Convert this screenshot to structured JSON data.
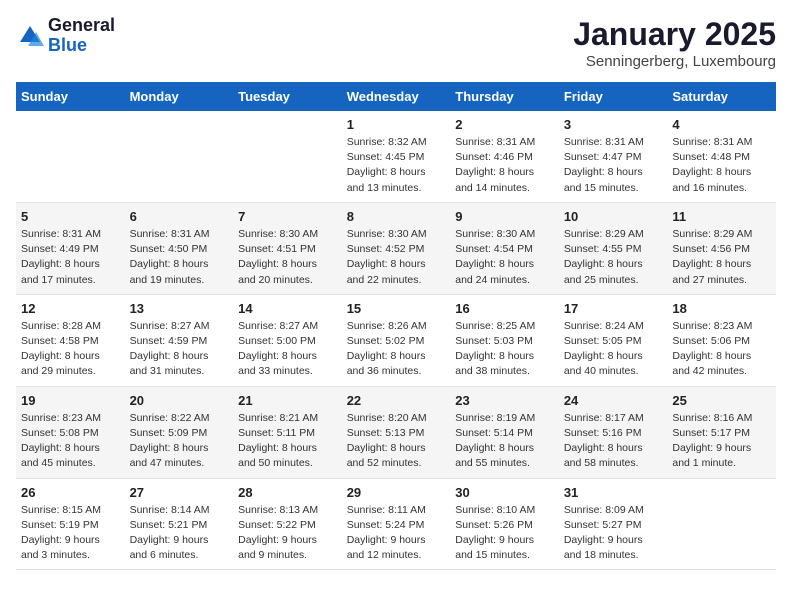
{
  "header": {
    "logo_general": "General",
    "logo_blue": "Blue",
    "title": "January 2025",
    "location": "Senningerberg, Luxembourg"
  },
  "days_of_week": [
    "Sunday",
    "Monday",
    "Tuesday",
    "Wednesday",
    "Thursday",
    "Friday",
    "Saturday"
  ],
  "weeks": [
    [
      {
        "day": "",
        "content": ""
      },
      {
        "day": "",
        "content": ""
      },
      {
        "day": "",
        "content": ""
      },
      {
        "day": "1",
        "content": "Sunrise: 8:32 AM\nSunset: 4:45 PM\nDaylight: 8 hours\nand 13 minutes."
      },
      {
        "day": "2",
        "content": "Sunrise: 8:31 AM\nSunset: 4:46 PM\nDaylight: 8 hours\nand 14 minutes."
      },
      {
        "day": "3",
        "content": "Sunrise: 8:31 AM\nSunset: 4:47 PM\nDaylight: 8 hours\nand 15 minutes."
      },
      {
        "day": "4",
        "content": "Sunrise: 8:31 AM\nSunset: 4:48 PM\nDaylight: 8 hours\nand 16 minutes."
      }
    ],
    [
      {
        "day": "5",
        "content": "Sunrise: 8:31 AM\nSunset: 4:49 PM\nDaylight: 8 hours\nand 17 minutes."
      },
      {
        "day": "6",
        "content": "Sunrise: 8:31 AM\nSunset: 4:50 PM\nDaylight: 8 hours\nand 19 minutes."
      },
      {
        "day": "7",
        "content": "Sunrise: 8:30 AM\nSunset: 4:51 PM\nDaylight: 8 hours\nand 20 minutes."
      },
      {
        "day": "8",
        "content": "Sunrise: 8:30 AM\nSunset: 4:52 PM\nDaylight: 8 hours\nand 22 minutes."
      },
      {
        "day": "9",
        "content": "Sunrise: 8:30 AM\nSunset: 4:54 PM\nDaylight: 8 hours\nand 24 minutes."
      },
      {
        "day": "10",
        "content": "Sunrise: 8:29 AM\nSunset: 4:55 PM\nDaylight: 8 hours\nand 25 minutes."
      },
      {
        "day": "11",
        "content": "Sunrise: 8:29 AM\nSunset: 4:56 PM\nDaylight: 8 hours\nand 27 minutes."
      }
    ],
    [
      {
        "day": "12",
        "content": "Sunrise: 8:28 AM\nSunset: 4:58 PM\nDaylight: 8 hours\nand 29 minutes."
      },
      {
        "day": "13",
        "content": "Sunrise: 8:27 AM\nSunset: 4:59 PM\nDaylight: 8 hours\nand 31 minutes."
      },
      {
        "day": "14",
        "content": "Sunrise: 8:27 AM\nSunset: 5:00 PM\nDaylight: 8 hours\nand 33 minutes."
      },
      {
        "day": "15",
        "content": "Sunrise: 8:26 AM\nSunset: 5:02 PM\nDaylight: 8 hours\nand 36 minutes."
      },
      {
        "day": "16",
        "content": "Sunrise: 8:25 AM\nSunset: 5:03 PM\nDaylight: 8 hours\nand 38 minutes."
      },
      {
        "day": "17",
        "content": "Sunrise: 8:24 AM\nSunset: 5:05 PM\nDaylight: 8 hours\nand 40 minutes."
      },
      {
        "day": "18",
        "content": "Sunrise: 8:23 AM\nSunset: 5:06 PM\nDaylight: 8 hours\nand 42 minutes."
      }
    ],
    [
      {
        "day": "19",
        "content": "Sunrise: 8:23 AM\nSunset: 5:08 PM\nDaylight: 8 hours\nand 45 minutes."
      },
      {
        "day": "20",
        "content": "Sunrise: 8:22 AM\nSunset: 5:09 PM\nDaylight: 8 hours\nand 47 minutes."
      },
      {
        "day": "21",
        "content": "Sunrise: 8:21 AM\nSunset: 5:11 PM\nDaylight: 8 hours\nand 50 minutes."
      },
      {
        "day": "22",
        "content": "Sunrise: 8:20 AM\nSunset: 5:13 PM\nDaylight: 8 hours\nand 52 minutes."
      },
      {
        "day": "23",
        "content": "Sunrise: 8:19 AM\nSunset: 5:14 PM\nDaylight: 8 hours\nand 55 minutes."
      },
      {
        "day": "24",
        "content": "Sunrise: 8:17 AM\nSunset: 5:16 PM\nDaylight: 8 hours\nand 58 minutes."
      },
      {
        "day": "25",
        "content": "Sunrise: 8:16 AM\nSunset: 5:17 PM\nDaylight: 9 hours\nand 1 minute."
      }
    ],
    [
      {
        "day": "26",
        "content": "Sunrise: 8:15 AM\nSunset: 5:19 PM\nDaylight: 9 hours\nand 3 minutes."
      },
      {
        "day": "27",
        "content": "Sunrise: 8:14 AM\nSunset: 5:21 PM\nDaylight: 9 hours\nand 6 minutes."
      },
      {
        "day": "28",
        "content": "Sunrise: 8:13 AM\nSunset: 5:22 PM\nDaylight: 9 hours\nand 9 minutes."
      },
      {
        "day": "29",
        "content": "Sunrise: 8:11 AM\nSunset: 5:24 PM\nDaylight: 9 hours\nand 12 minutes."
      },
      {
        "day": "30",
        "content": "Sunrise: 8:10 AM\nSunset: 5:26 PM\nDaylight: 9 hours\nand 15 minutes."
      },
      {
        "day": "31",
        "content": "Sunrise: 8:09 AM\nSunset: 5:27 PM\nDaylight: 9 hours\nand 18 minutes."
      },
      {
        "day": "",
        "content": ""
      }
    ]
  ]
}
